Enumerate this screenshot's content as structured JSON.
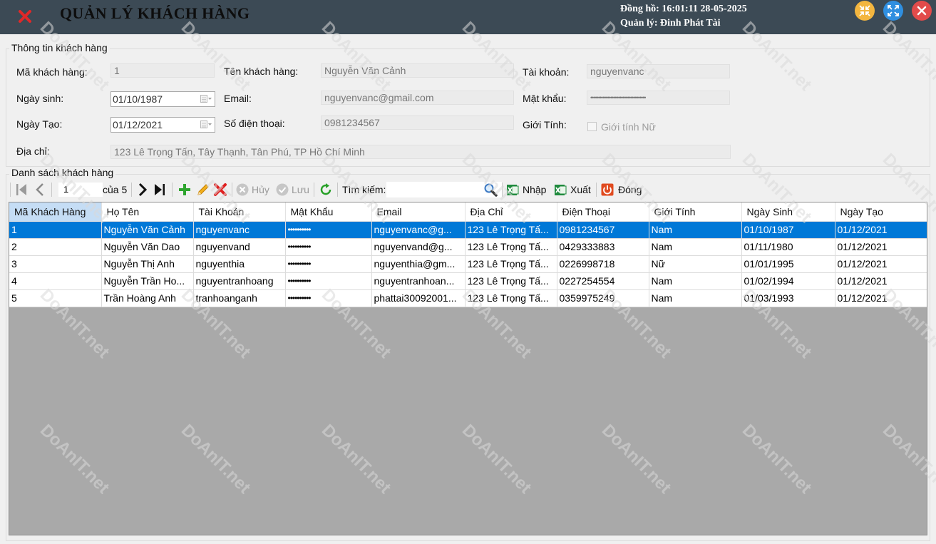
{
  "titlebar": {
    "title": "QUẢN LÝ KHÁCH HÀNG",
    "clock": "Đồng hồ: 16:01:11 28-05-2025",
    "manager": "Quản lý: Đinh Phát Tài"
  },
  "info": {
    "legend": "Thông tin khách hàng",
    "ma_kh_label": "Mã khách hàng:",
    "ma_kh_value": "1",
    "ten_kh_label": "Tên khách hàng:",
    "ten_kh_value": "Nguyễn Văn Cảnh",
    "tai_khoan_label": "Tài khoản:",
    "tai_khoan_value": "nguyenvanc",
    "ngay_sinh_label": "Ngày sinh:",
    "ngay_sinh_value": "01/10/1987",
    "email_label": "Email:",
    "email_value": "nguyenvanc@gmail.com",
    "mat_khau_label": "Mật khẩu:",
    "mat_khau_value": "••••••••••••••••••••••••••••••••••••",
    "ngay_tao_label": "Ngày Tạo:",
    "ngay_tao_value": "01/12/2021",
    "sdt_label": "Số điện thoại:",
    "sdt_value": "0981234567",
    "gioi_tinh_label": "Giới Tính:",
    "gioi_tinh_check": "Giới tính Nữ",
    "dia_chi_label": "Địa chỉ:",
    "dia_chi_value": "123 Lê Trọng Tấn, Tây Thạnh, Tân Phú, TP Hồ Chí Minh"
  },
  "list": {
    "legend": "Danh sách khách hàng"
  },
  "toolbar": {
    "position": "1",
    "of_count": "của 5",
    "cancel": "Hủy",
    "save": "Lưu",
    "search_label": "Tìm kiếm:",
    "import": "Nhập",
    "export": "Xuất",
    "close": "Đóng"
  },
  "grid": {
    "columns": [
      "Mã Khách Hàng",
      "Họ Tên",
      "Tài Khoản",
      "Mật Khẩu",
      "Email",
      "Địa Chỉ",
      "Điện Thoại",
      "Giới Tính",
      "Ngày Sinh",
      "Ngày Tạo"
    ],
    "rows": [
      [
        "1",
        "Nguyễn Văn Cảnh",
        "nguyenvanc",
        "••••••••••",
        "nguyenvanc@g...",
        "123 Lê Trọng Tấ...",
        "0981234567",
        "Nam",
        "01/10/1987",
        "01/12/2021"
      ],
      [
        "2",
        "Nguyễn Văn Dao",
        "nguyenvand",
        "••••••••••",
        "nguyenvand@g...",
        "123 Lê Trọng Tấ...",
        "0429333883",
        "Nam",
        "01/11/1980",
        "01/12/2021"
      ],
      [
        "3",
        "Nguyễn Thị Anh",
        "nguyenthia",
        "••••••••••",
        "nguyenthia@gm...",
        "123 Lê Trọng Tấ...",
        "0226998718",
        "Nữ",
        "01/01/1995",
        "01/12/2021"
      ],
      [
        "4",
        "Nguyễn Trần Ho...",
        "nguyentranhoang",
        "••••••••••",
        "nguyentranhoan...",
        "123 Lê Trọng Tấ...",
        "0227254554",
        "Nam",
        "01/02/1994",
        "01/12/2021"
      ],
      [
        "5",
        "Trần Hoàng Anh",
        "tranhoanganh",
        "••••••••••",
        "phattai30092001...",
        "123 Lê Trọng Tấ...",
        "0359975249",
        "Nam",
        "01/03/1993",
        "01/12/2021"
      ]
    ]
  },
  "watermark": "DoAnIT.net",
  "colors": {
    "titlebar": "#3c4a55",
    "selection": "#0078d7",
    "grid_bg": "#a9a9a9"
  }
}
